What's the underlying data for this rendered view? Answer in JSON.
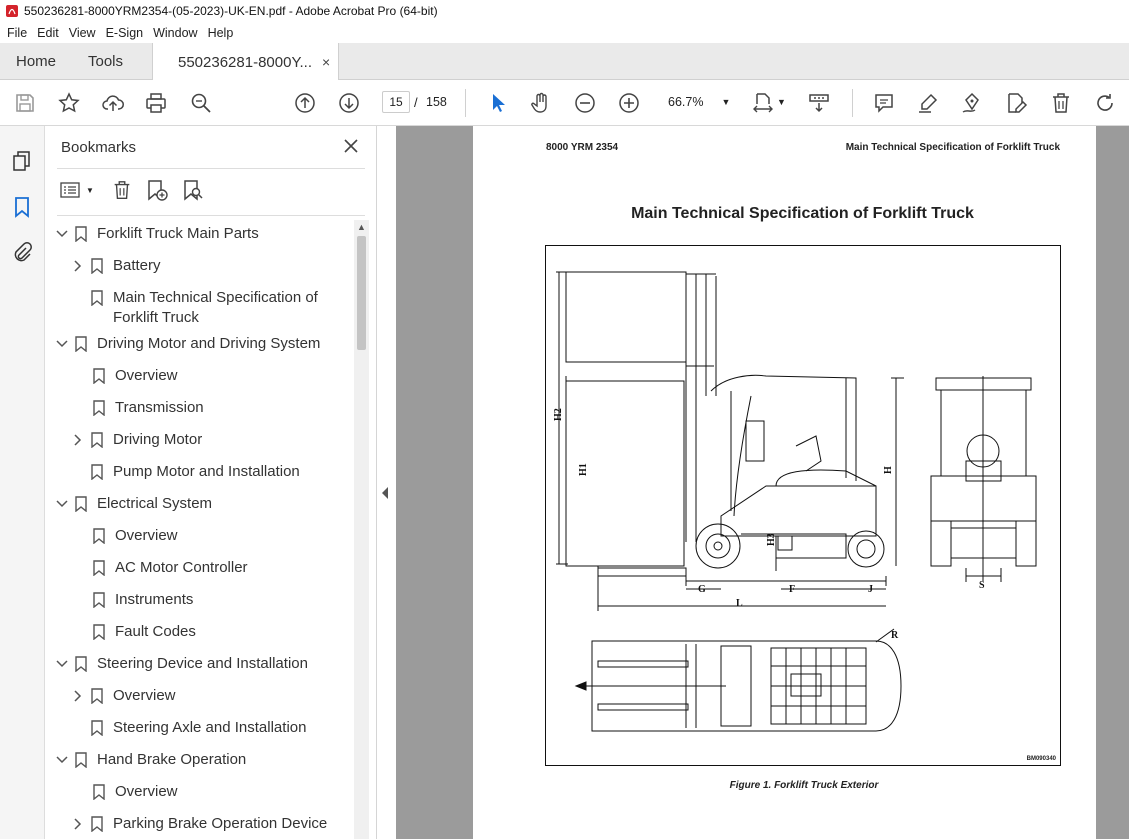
{
  "window": {
    "title": "550236281-8000YRM2354-(05-2023)-UK-EN.pdf - Adobe Acrobat Pro (64-bit)"
  },
  "menu": [
    "File",
    "Edit",
    "View",
    "E-Sign",
    "Window",
    "Help"
  ],
  "tabs": {
    "home": "Home",
    "tools": "Tools",
    "document": "550236281-8000Y...",
    "close": "×"
  },
  "toolbar": {
    "current_page": "15",
    "page_sep": "/",
    "total_pages": "158",
    "zoom": "66.7%"
  },
  "panel": {
    "title": "Bookmarks",
    "items": [
      {
        "label": "Forklift Truck Main Parts"
      },
      {
        "label": "Battery"
      },
      {
        "label": "Main Technical Specification of",
        "label2": "Forklift Truck"
      },
      {
        "label": "Driving Motor and Driving System"
      },
      {
        "label": "Overview"
      },
      {
        "label": "Transmission"
      },
      {
        "label": "Driving Motor"
      },
      {
        "label": "Pump Motor and Installation"
      },
      {
        "label": "Electrical System"
      },
      {
        "label": "Overview"
      },
      {
        "label": "AC Motor Controller"
      },
      {
        "label": "Instruments"
      },
      {
        "label": "Fault Codes"
      },
      {
        "label": "Steering Device and Installation"
      },
      {
        "label": "Overview"
      },
      {
        "label": "Steering Axle and Installation"
      },
      {
        "label": "Hand Brake Operation"
      },
      {
        "label": "Overview"
      },
      {
        "label": "Parking Brake Operation Device"
      }
    ]
  },
  "document": {
    "header_left": "8000 YRM 2354",
    "header_right": "Main Technical Specification of Forklift Truck",
    "title": "Main Technical Specification of Forklift Truck",
    "figure_code": "BM090340",
    "caption": "Figure 1. Forklift Truck Exterior",
    "dim_labels": {
      "h2": "H2",
      "h1": "H1",
      "h3": "H3",
      "h": "H",
      "g": "G",
      "f": "F",
      "j": "J",
      "l": "L",
      "s": "S",
      "r": "R"
    }
  }
}
